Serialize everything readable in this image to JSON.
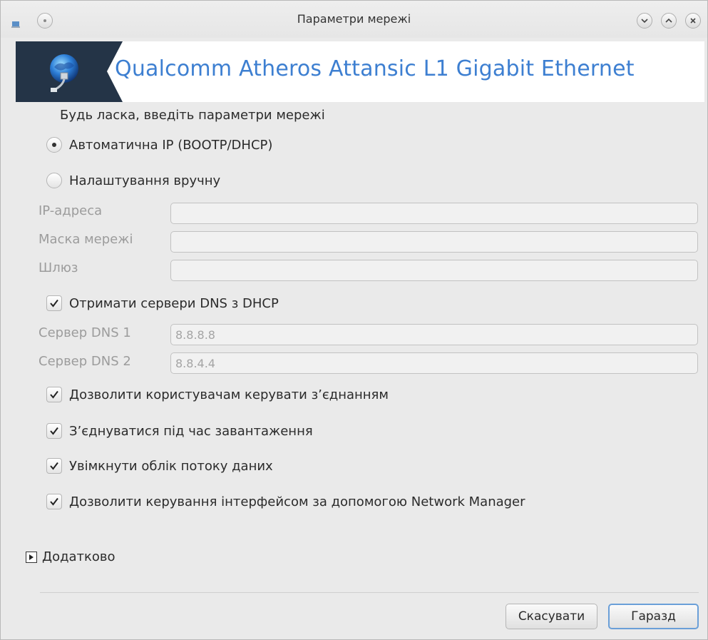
{
  "window": {
    "title": "Параметри мережі",
    "controls": [
      "chevron-down-icon",
      "chevron-up-icon",
      "close-icon"
    ]
  },
  "banner": {
    "title": "Qualcomm Atheros Attansic L1 Gigabit Ethernet",
    "logo_icon": "network-globe-icon",
    "colors": {
      "dark": "#243447",
      "title": "#3d7fd1"
    }
  },
  "form": {
    "prompt": "Будь ласка, введіть параметри мережі",
    "ip_mode": {
      "options": [
        {
          "label": "Автоматична IP (BOOTP/DHCP)",
          "selected": true
        },
        {
          "label": "Налаштування вручну",
          "selected": false
        }
      ]
    },
    "ip_address": {
      "label": "IP-адреса",
      "value": ""
    },
    "netmask": {
      "label": "Маска мережі",
      "value": ""
    },
    "gateway": {
      "label": "Шлюз",
      "value": ""
    },
    "dns_from_dhcp": {
      "label": "Отримати сервери DNS з DHCP",
      "checked": true
    },
    "dns1": {
      "label": "Сервер DNS 1",
      "value": "8.8.8.8"
    },
    "dns2": {
      "label": "Сервер DNS 2",
      "value": "8.8.4.4"
    },
    "options": [
      {
        "label": "Дозволити користувачам керувати з’єднанням",
        "checked": true
      },
      {
        "label": "З’єднуватися під час завантаження",
        "checked": true
      },
      {
        "label": "Увімкнути облік потоку даних",
        "checked": true
      },
      {
        "label": "Дозволити керування інтерфейсом за допомогою Network Manager",
        "checked": true
      }
    ],
    "advanced_label": "Додатково"
  },
  "buttons": {
    "cancel": "Скасувати",
    "ok": "Гаразд"
  }
}
